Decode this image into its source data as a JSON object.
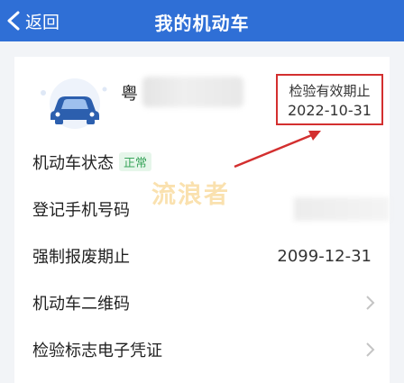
{
  "header": {
    "back_label": "返回",
    "title": "我的机动车"
  },
  "vehicle": {
    "plate_prefix": "粤",
    "inspection_label": "检验有效期止",
    "inspection_date": "2022-10-31"
  },
  "rows": [
    {
      "label": "机动车状态",
      "badge": "正常"
    },
    {
      "label": "登记手机号码"
    },
    {
      "label": "强制报废期止",
      "value": "2099-12-31"
    },
    {
      "label": "机动车二维码"
    },
    {
      "label": "检验标志电子凭证"
    }
  ],
  "watermark": "流浪者",
  "colors": {
    "header_bg": "#2f6fd6",
    "highlight_red": "#d32f2f",
    "badge_green": "#3aa55c",
    "car_blue": "#2c5fae"
  }
}
